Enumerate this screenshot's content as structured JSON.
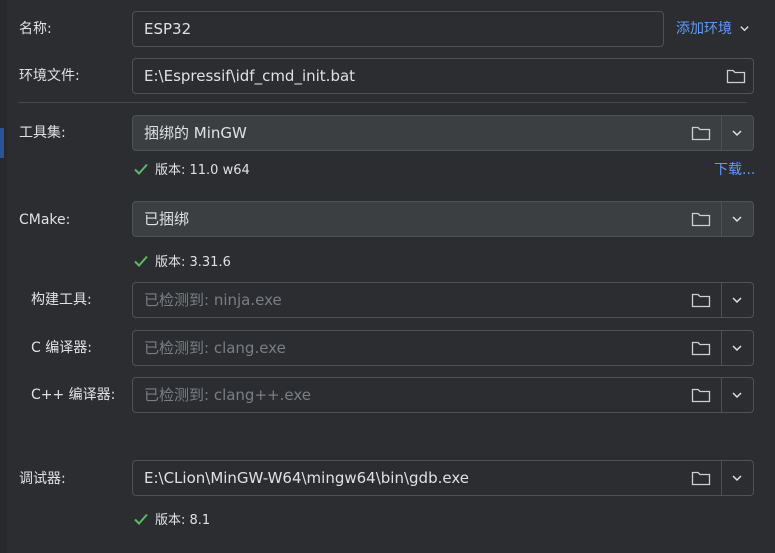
{
  "name": {
    "label": "名称:",
    "value": "ESP32",
    "add_env_label": "添加环境"
  },
  "env_file": {
    "label": "环境文件:",
    "value": "E:\\Espressif\\idf_cmd_init.bat"
  },
  "toolset": {
    "label": "工具集:",
    "value": "捆绑的 MinGW",
    "version_text": "版本: 11.0 w64",
    "download_label": "下载..."
  },
  "cmake": {
    "label": "CMake:",
    "value": "已捆绑",
    "version_text": "版本: 3.31.6"
  },
  "build_tool": {
    "label": "构建工具:",
    "placeholder": "已检测到: ninja.exe"
  },
  "c_compiler": {
    "label": "C 编译器:",
    "placeholder": "已检测到: clang.exe"
  },
  "cpp_compiler": {
    "label": "C++ 编译器:",
    "placeholder": "已检测到: clang++.exe"
  },
  "debugger": {
    "label": "调试器:",
    "value": "E:\\CLion\\MinGW-W64\\mingw64\\bin\\gdb.exe",
    "version_text": "版本: 8.1"
  },
  "colors": {
    "background": "#2b2d30",
    "field_border": "#4e5157",
    "combo_fill": "#3c3f41",
    "link": "#5e9bf5",
    "check": "#5fb865",
    "placeholder": "#7a7e85"
  },
  "icons": [
    "folder-icon",
    "chevron-down-icon",
    "check-icon"
  ]
}
